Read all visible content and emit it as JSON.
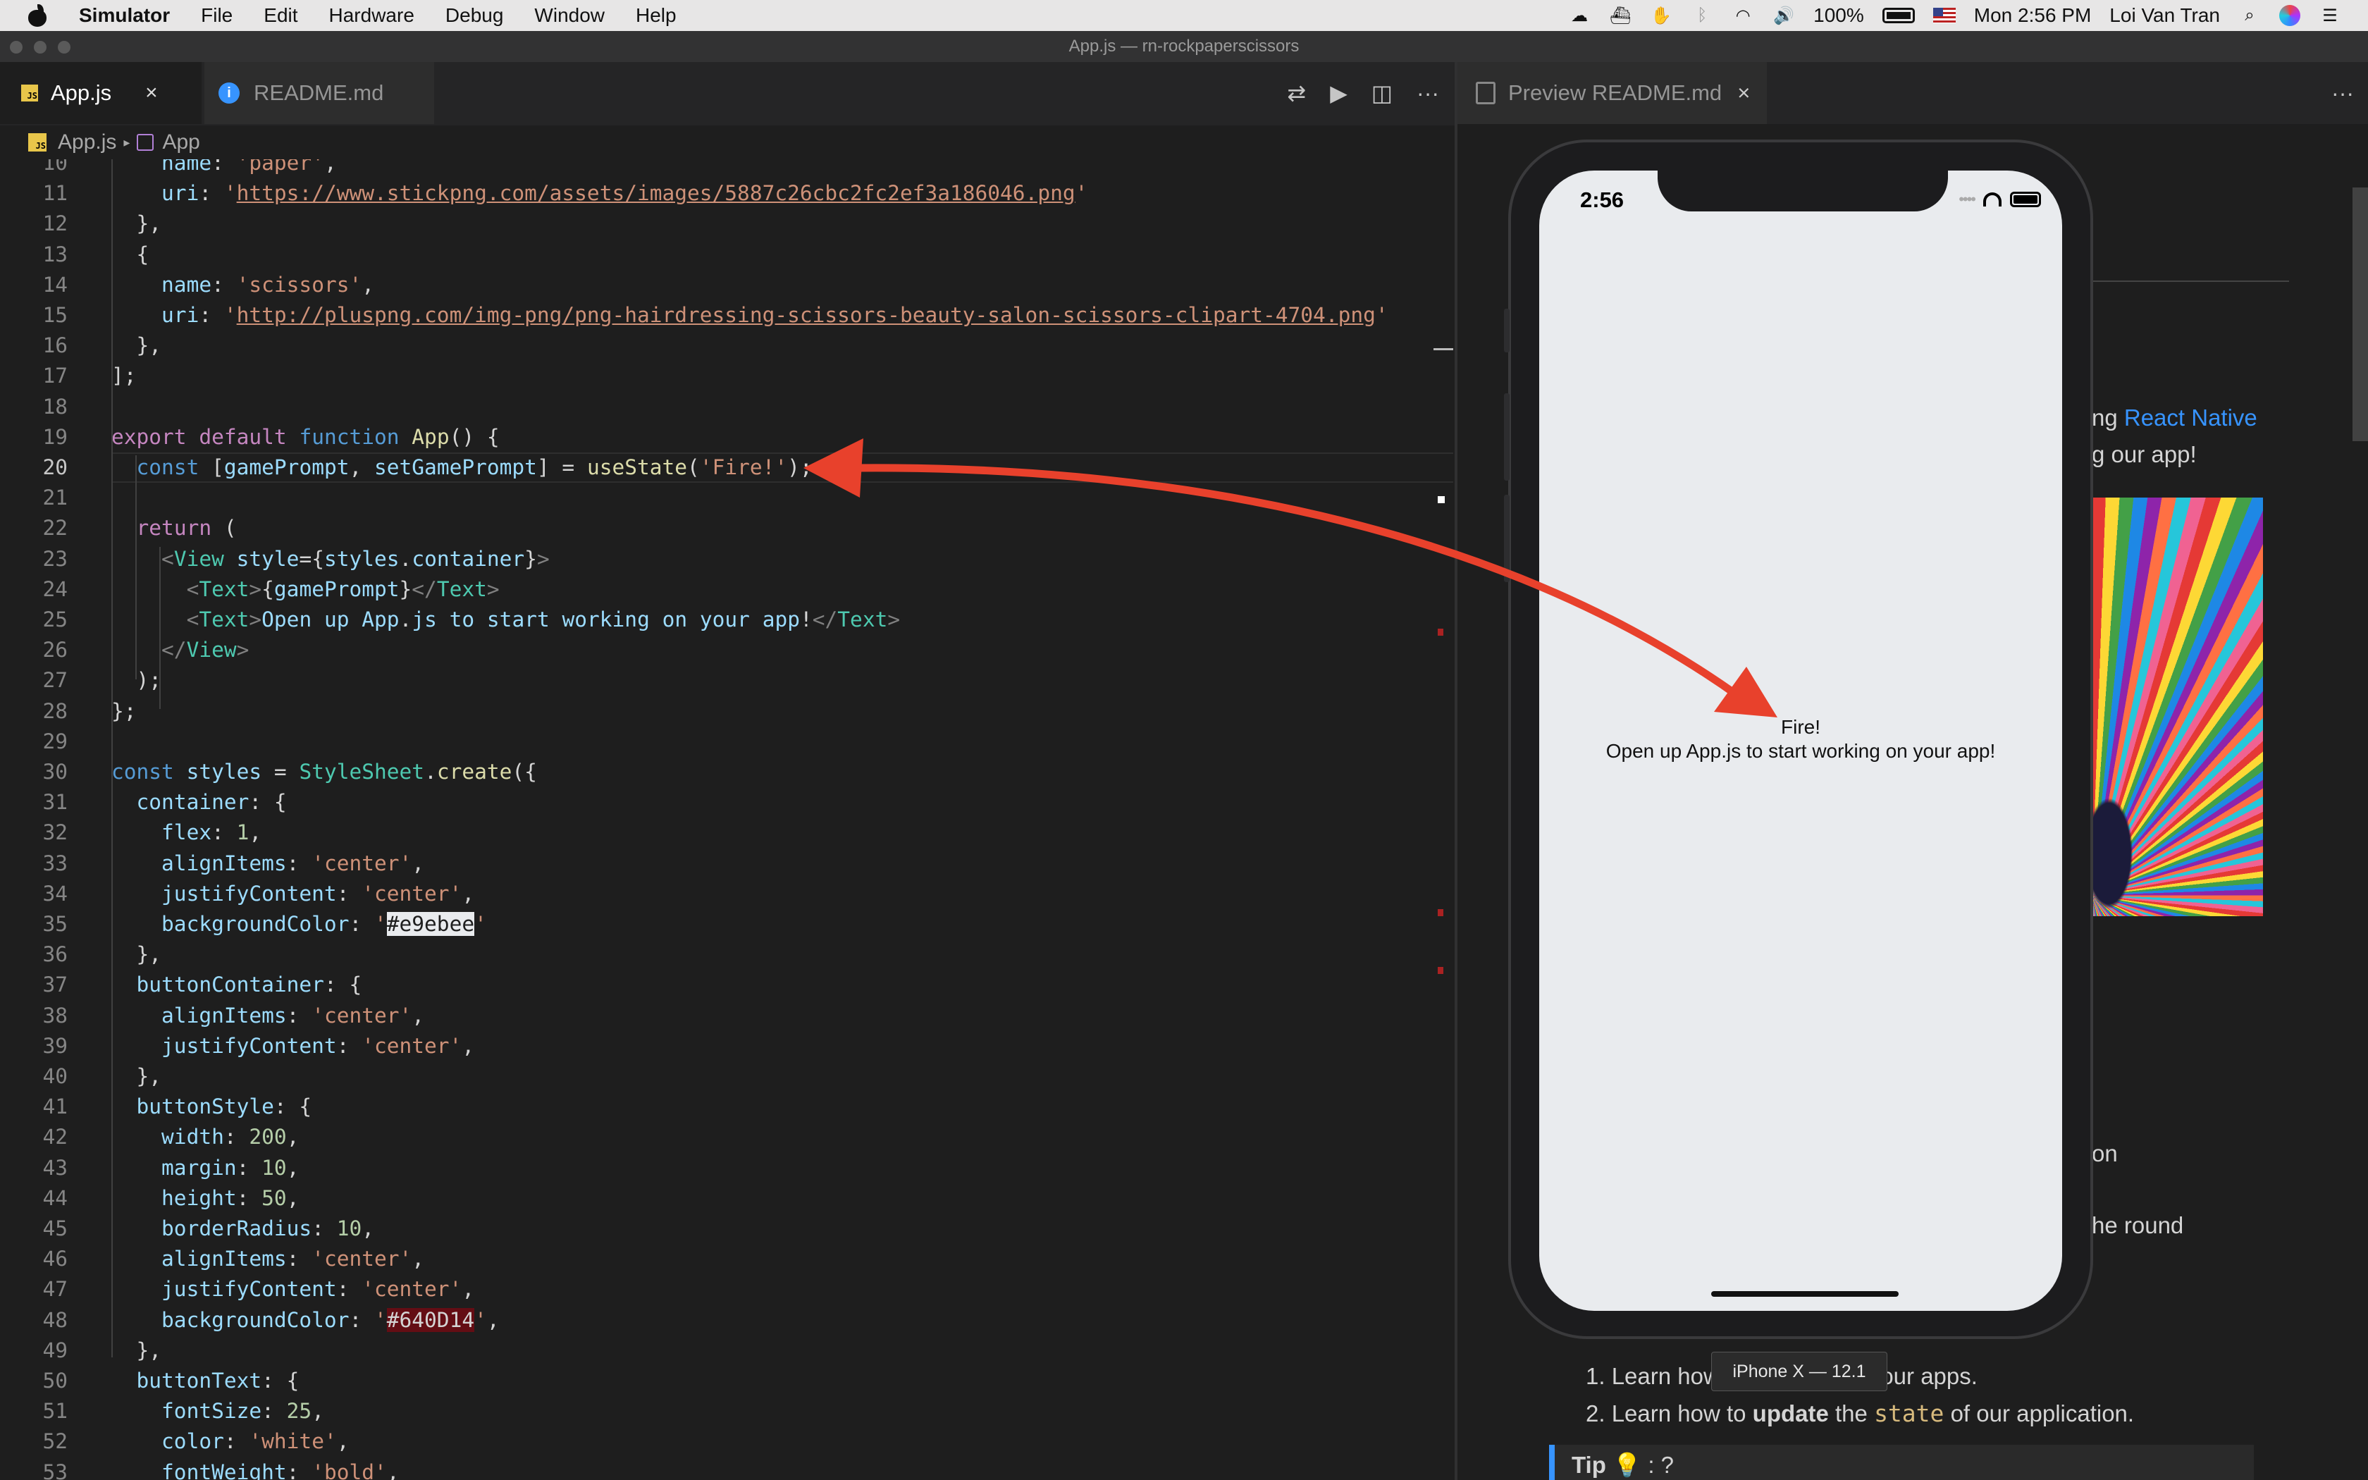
{
  "menubar": {
    "app_name": "Simulator",
    "items": [
      "File",
      "Edit",
      "Hardware",
      "Debug",
      "Window",
      "Help"
    ],
    "battery": "100%",
    "clock": "Mon 2:56 PM",
    "user": "Loi Van Tran"
  },
  "window": {
    "title": "App.js — rn-rockpaperscissors"
  },
  "editor_tabs": [
    {
      "label": "App.js",
      "close": "×"
    },
    {
      "label": "README.md"
    }
  ],
  "toolbar_icons": [
    "git-compare-icon",
    "run-icon",
    "split-editor-icon",
    "more-icon"
  ],
  "breadcrumb": {
    "file": "App.js",
    "symbol": "App"
  },
  "code": {
    "current_line": 20,
    "lines": [
      {
        "n": "10",
        "text": "    name: 'paper',"
      },
      {
        "n": "11",
        "text": "    uri: 'https://www.stickpng.com/assets/images/5887c26cbc2fc2ef3a186046.png'"
      },
      {
        "n": "12",
        "text": "  },"
      },
      {
        "n": "13",
        "text": "  {"
      },
      {
        "n": "14",
        "text": "    name: 'scissors',"
      },
      {
        "n": "15",
        "text": "    uri: 'http://pluspng.com/img-png/png-hairdressing-scissors-beauty-salon-scissors-clipart-4704.png'"
      },
      {
        "n": "16",
        "text": "  },"
      },
      {
        "n": "17",
        "text": "];"
      },
      {
        "n": "18",
        "text": ""
      },
      {
        "n": "19",
        "text": "export default function App() {"
      },
      {
        "n": "20",
        "text": "  const [gamePrompt, setGamePrompt] = useState('Fire!');"
      },
      {
        "n": "21",
        "text": ""
      },
      {
        "n": "22",
        "text": "  return ("
      },
      {
        "n": "23",
        "text": "    <View style={styles.container}>"
      },
      {
        "n": "24",
        "text": "      <Text>{gamePrompt}</Text>"
      },
      {
        "n": "25",
        "text": "      <Text>Open up App.js to start working on your app!</Text>"
      },
      {
        "n": "26",
        "text": "    </View>"
      },
      {
        "n": "27",
        "text": "  );"
      },
      {
        "n": "28",
        "text": "};"
      },
      {
        "n": "29",
        "text": ""
      },
      {
        "n": "30",
        "text": "const styles = StyleSheet.create({"
      },
      {
        "n": "31",
        "text": "  container: {"
      },
      {
        "n": "32",
        "text": "    flex: 1,"
      },
      {
        "n": "33",
        "text": "    alignItems: 'center',"
      },
      {
        "n": "34",
        "text": "    justifyContent: 'center',"
      },
      {
        "n": "35",
        "text": "    backgroundColor: '#e9ebee'"
      },
      {
        "n": "36",
        "text": "  },"
      },
      {
        "n": "37",
        "text": "  buttonContainer: {"
      },
      {
        "n": "38",
        "text": "    alignItems: 'center',"
      },
      {
        "n": "39",
        "text": "    justifyContent: 'center',"
      },
      {
        "n": "40",
        "text": "  },"
      },
      {
        "n": "41",
        "text": "  buttonStyle: {"
      },
      {
        "n": "42",
        "text": "    width: 200,"
      },
      {
        "n": "43",
        "text": "    margin: 10,"
      },
      {
        "n": "44",
        "text": "    height: 50,"
      },
      {
        "n": "45",
        "text": "    borderRadius: 10,"
      },
      {
        "n": "46",
        "text": "    alignItems: 'center',"
      },
      {
        "n": "47",
        "text": "    justifyContent: 'center',"
      },
      {
        "n": "48",
        "text": "    backgroundColor: '#640D14',"
      },
      {
        "n": "49",
        "text": "  },"
      },
      {
        "n": "50",
        "text": "  buttonText: {"
      },
      {
        "n": "51",
        "text": "    fontSize: 25,"
      },
      {
        "n": "52",
        "text": "    color: 'white',"
      },
      {
        "n": "53",
        "text": "    fontWeight: 'bold',"
      }
    ]
  },
  "preview": {
    "tab_label": "Preview README.md",
    "close": "×",
    "react_native_prefix": "ng ",
    "react_native_link": "React Native",
    "line2": "g our app!",
    "fragment_on": "on",
    "fragment_round": "he round",
    "list": [
      {
        "num": "1.",
        "before": "Learn how",
        "after": "o our apps."
      },
      {
        "num": "2.",
        "before": "Learn how to ",
        "bold": "update",
        "mid": " the ",
        "code": "state",
        "after": " of our application."
      }
    ],
    "tip_label": "Tip",
    "tip_icon": "💡",
    "tip_rest": ": ?"
  },
  "simulator": {
    "time": "2:56",
    "prompt": "Fire!",
    "body_text": "Open up App.js to start working on your app!",
    "device_label": "iPhone X — 12.1",
    "screen_color": "#e9ebee"
  },
  "colors": {
    "annotation_arrow": "#e8412c",
    "editor_bg": "#1e1e1e",
    "accent_link": "#3794ff"
  }
}
